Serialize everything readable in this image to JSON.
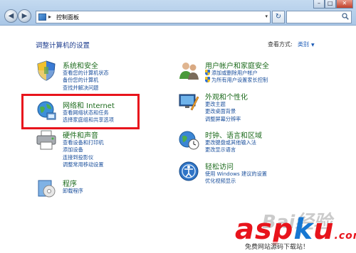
{
  "window": {
    "address_text": "控制面板",
    "address_chevron": "▸",
    "address_dropdown": "▾",
    "nav_back": "◀",
    "nav_forward": "▶",
    "refresh_glyph": "↻",
    "buttons": {
      "minimize": "–",
      "maximize": "□",
      "close": "✕"
    }
  },
  "header": {
    "title": "调整计算机的设置",
    "view_by_label": "查看方式:",
    "view_by_value": "类别",
    "view_by_caret": "▼"
  },
  "categories": {
    "system": {
      "title": "系统和安全",
      "links": [
        "查看您的计算机状态",
        "备份您的计算机",
        "查找并解决问题"
      ]
    },
    "network": {
      "title": "网络和 Internet",
      "links": [
        "查看网络状态和任务",
        "选择家庭组和共享选项"
      ]
    },
    "hardware": {
      "title": "硬件和声音",
      "links": [
        "查看设备和打印机",
        "添加设备",
        "连接到投影仪",
        "调整常用移动设置"
      ]
    },
    "programs": {
      "title": "程序",
      "links": [
        "卸载程序"
      ]
    },
    "users": {
      "title": "用户帐户和家庭安全",
      "links": [
        "添加或删除用户帐户",
        "为所有用户设置家长控制"
      ]
    },
    "appearance": {
      "title": "外观和个性化",
      "links": [
        "更改主题",
        "更改桌面背景",
        "调整屏幕分辨率"
      ]
    },
    "clock": {
      "title": "时钟、语言和区域",
      "links": [
        "更改键盘或其他输入法",
        "更改显示语言"
      ]
    },
    "ease": {
      "title": "轻松访问",
      "links": [
        "使用 Windows 建议的设置",
        "优化视频显示"
      ]
    }
  },
  "watermark": {
    "baidu": "Bai经验",
    "aspku_main": "asp",
    "aspku_k": "k",
    "aspku_u": "u",
    "aspku_tail": ".com",
    "aspku_sub": "免费网站源码下载站！"
  },
  "colors": {
    "title_bar": "#b5cfea",
    "category_title": "#1d6b1d",
    "link": "#1a4f9c",
    "highlight": "#e8141c"
  }
}
